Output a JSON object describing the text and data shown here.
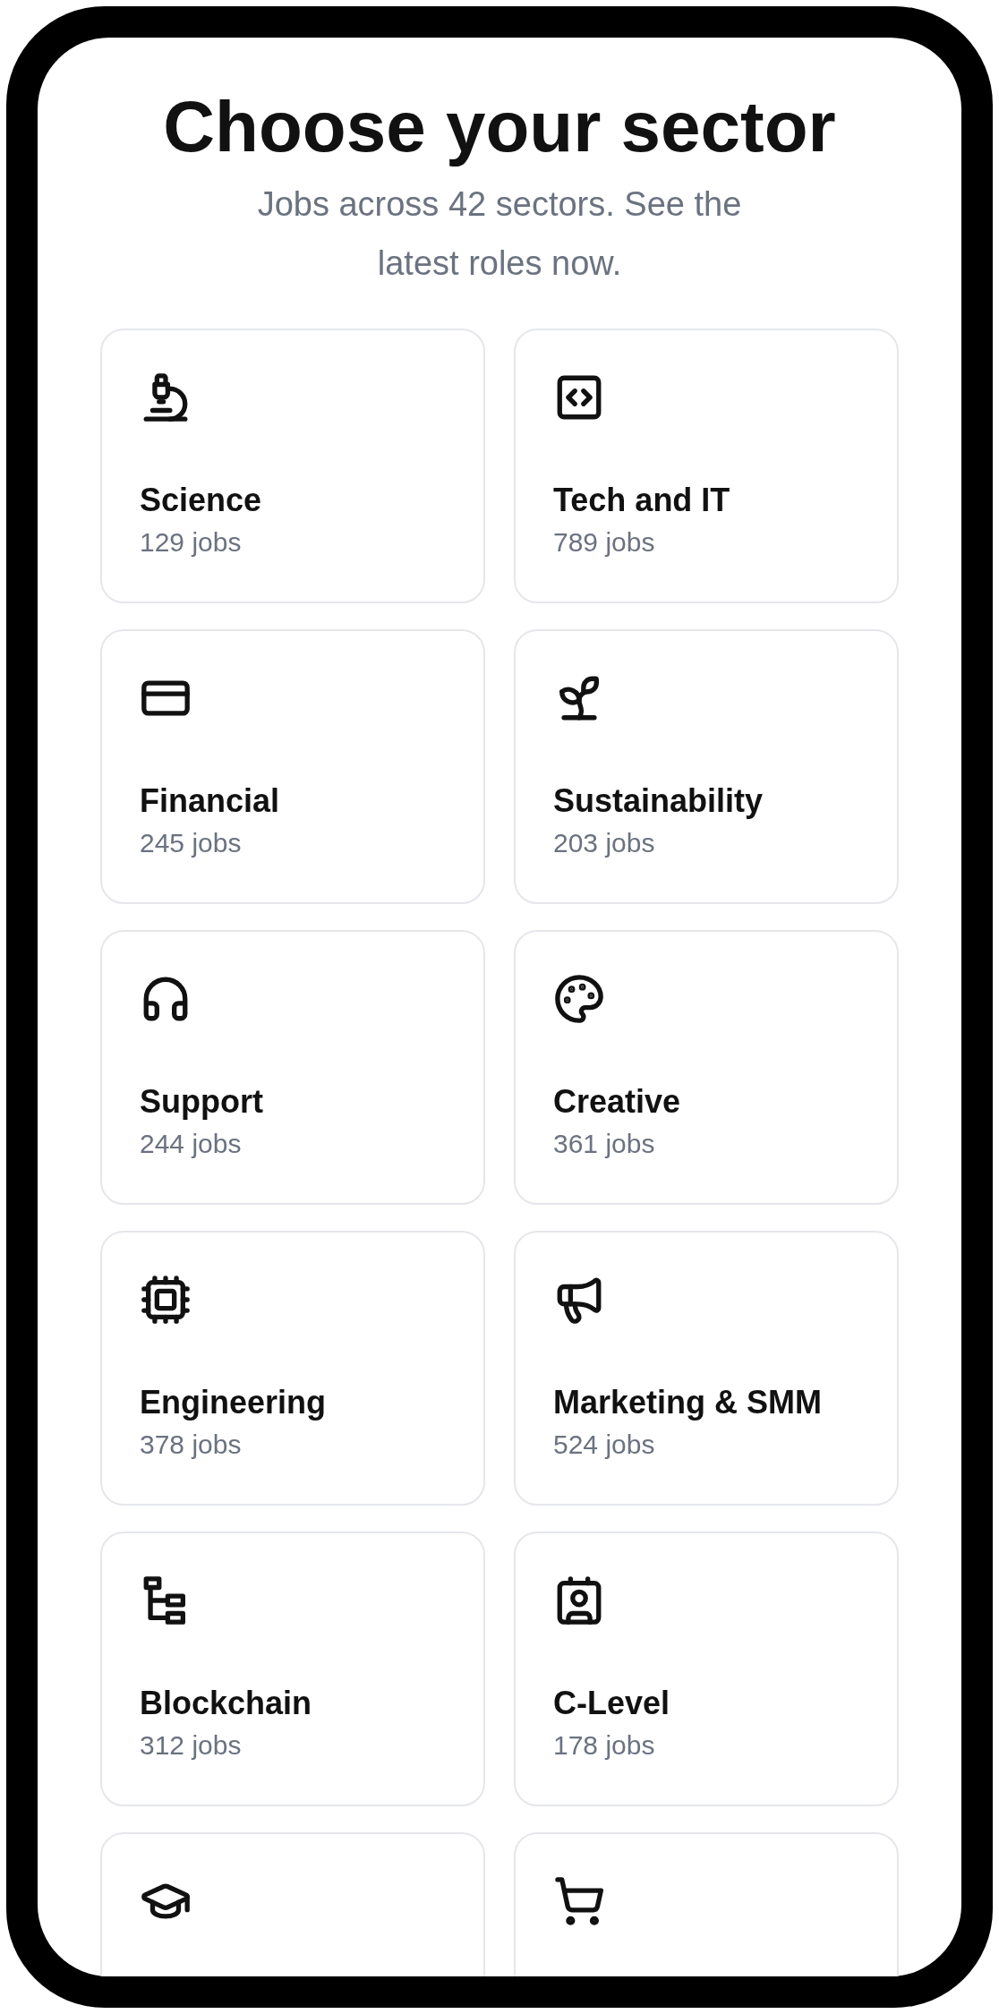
{
  "heading": {
    "title": "Choose your sector",
    "subtitle": "Jobs across 42 sectors. See the latest roles now."
  },
  "sectors": [
    {
      "kind": "full",
      "name": "Science",
      "count": "129 jobs"
    },
    {
      "kind": "full",
      "name": "Tech and IT",
      "count": "789 jobs"
    },
    {
      "kind": "full",
      "name": "Financial",
      "count": "245 jobs"
    },
    {
      "kind": "full",
      "name": "Sustainability",
      "count": "203 jobs"
    },
    {
      "kind": "full",
      "name": "Support",
      "count": "244 jobs"
    },
    {
      "kind": "full",
      "name": "Creative",
      "count": "361 jobs"
    },
    {
      "kind": "full",
      "name": "Engineering",
      "count": "378 jobs"
    },
    {
      "kind": "full",
      "name": "Marketing & SMM",
      "count": "524 jobs"
    },
    {
      "kind": "full",
      "name": "Blockchain",
      "count": "312 jobs"
    },
    {
      "kind": "full",
      "name": "C-Level",
      "count": "178 jobs"
    },
    {
      "kind": "cut"
    },
    {
      "kind": "cut"
    }
  ]
}
